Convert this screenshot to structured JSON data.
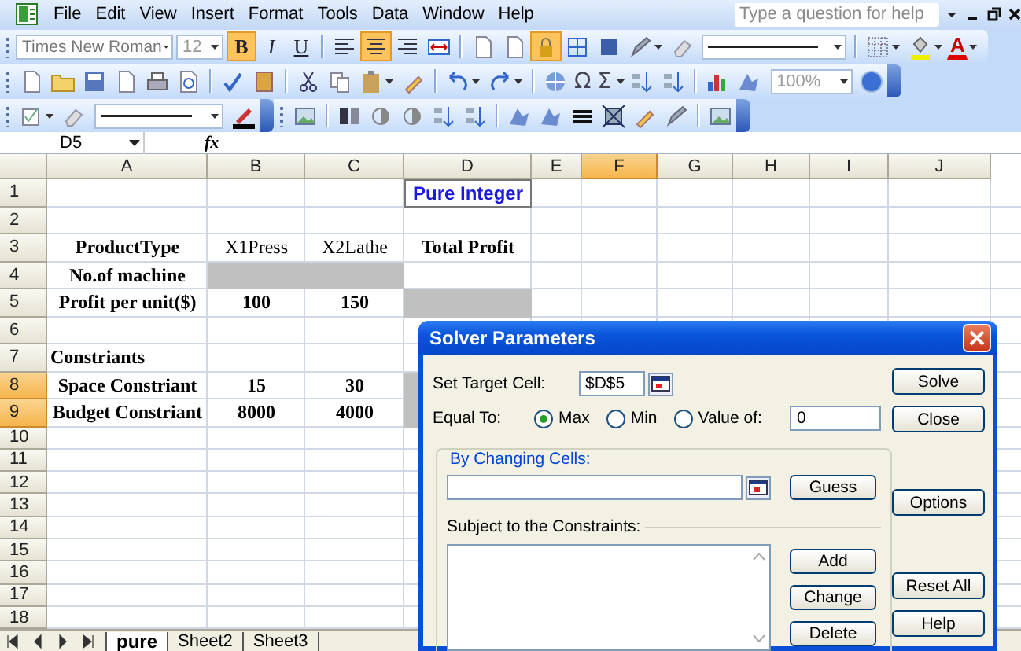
{
  "menu": [
    "File",
    "Edit",
    "View",
    "Insert",
    "Format",
    "Tools",
    "Data",
    "Window",
    "Help"
  ],
  "help_box": {
    "placeholder": "Type a question for help"
  },
  "formatting_toolbar": {
    "font": "Times New Roman",
    "size": "12",
    "style_buttons": [
      {
        "label": "B",
        "selected": true
      },
      {
        "label": "I",
        "selected": false
      },
      {
        "label": "U",
        "selected": false
      }
    ],
    "tool_buttons": [
      {
        "selected": false
      },
      {
        "selected": true
      },
      {
        "selected": false
      },
      {
        "selected": false
      },
      {
        "selected": false
      },
      {
        "selected": false
      },
      {
        "selected": true
      },
      {
        "selected": false
      },
      {
        "selected": false
      },
      {
        "selected": false
      },
      {
        "selected": false
      },
      {
        "selected": false
      },
      {
        "selected": false
      }
    ],
    "font_color_label": "A"
  },
  "standard_toolbar": {
    "symbols": [
      "Ω",
      "Σ"
    ],
    "zoom": "100%"
  },
  "formula_bar": {
    "name_box": "D5",
    "function_label": "fx"
  },
  "columns": [
    {
      "label": "A",
      "selected": false
    },
    {
      "label": "B",
      "selected": false
    },
    {
      "label": "C",
      "selected": false
    },
    {
      "label": "D",
      "selected": false
    },
    {
      "label": "E",
      "selected": false
    },
    {
      "label": "F",
      "selected": true
    },
    {
      "label": "G",
      "selected": false
    },
    {
      "label": "H",
      "selected": false
    },
    {
      "label": "I",
      "selected": false
    },
    {
      "label": "J",
      "selected": false
    }
  ],
  "rows": [
    {
      "label": "1",
      "selected": false,
      "cells": [
        {
          "kind": "empty"
        },
        {
          "kind": "empty"
        },
        {
          "kind": "empty"
        },
        {
          "kind": "title",
          "text": "Pure Integer"
        }
      ]
    },
    {
      "label": "2",
      "selected": false
    },
    {
      "label": "3",
      "selected": false,
      "cells": [
        {
          "kind": "bold",
          "text": "ProductType"
        },
        {
          "kind": "plain",
          "text": "X1Press"
        },
        {
          "kind": "plain",
          "text": "X2Lathe"
        },
        {
          "kind": "bold",
          "text": "Total Profit"
        }
      ]
    },
    {
      "label": "4",
      "selected": false,
      "cells": [
        {
          "kind": "bold",
          "text": "No.of machine"
        },
        {
          "kind": "shaded"
        },
        {
          "kind": "shaded"
        }
      ]
    },
    {
      "label": "5",
      "selected": false,
      "cells": [
        {
          "kind": "bold",
          "text": "Profit per unit($)"
        },
        {
          "kind": "bold",
          "text": "100"
        },
        {
          "kind": "bold",
          "text": "150"
        },
        {
          "kind": "shaded"
        }
      ]
    },
    {
      "label": "6",
      "selected": false
    },
    {
      "label": "7",
      "selected": false,
      "cells": [
        {
          "kind": "bold-left",
          "text": "Constriants"
        }
      ]
    },
    {
      "label": "8",
      "selected": true,
      "cells": [
        {
          "kind": "bold",
          "text": "Space Constriant"
        },
        {
          "kind": "bold",
          "text": "15"
        },
        {
          "kind": "bold",
          "text": "30"
        },
        {
          "kind": "shaded"
        }
      ]
    },
    {
      "label": "9",
      "selected": true,
      "cells": [
        {
          "kind": "bold",
          "text": "Budget Constriant"
        },
        {
          "kind": "bold",
          "text": "8000"
        },
        {
          "kind": "bold",
          "text": "4000"
        },
        {
          "kind": "shaded"
        }
      ]
    },
    {
      "label": "10",
      "selected": false
    },
    {
      "label": "11",
      "selected": false
    },
    {
      "label": "12",
      "selected": false
    },
    {
      "label": "13",
      "selected": false
    },
    {
      "label": "14",
      "selected": false
    },
    {
      "label": "15",
      "selected": false
    },
    {
      "label": "16",
      "selected": false
    },
    {
      "label": "17",
      "selected": false
    },
    {
      "label": "18",
      "selected": false
    }
  ],
  "sheet_tabs": [
    {
      "label": "pure",
      "selected": true
    },
    {
      "label": "Sheet2",
      "selected": false
    },
    {
      "label": "Sheet3",
      "selected": false
    }
  ],
  "solver": {
    "title": "Solver Parameters",
    "target_label": "Set Target Cell:",
    "target_value": "$D$5",
    "equal_label": "Equal To:",
    "equal_to": [
      {
        "label": "Max",
        "selected": true
      },
      {
        "label": "Min",
        "selected": false
      },
      {
        "label": "Value of:",
        "selected": false
      }
    ],
    "value_of": "0",
    "changing_label": "By Changing Cells:",
    "guess": "Guess",
    "constraints_label": "Subject to the Constraints:",
    "constraint_buttons": [
      "Add",
      "Change",
      "Delete"
    ],
    "side_buttons": [
      "Solve",
      "Close",
      "Options",
      "Reset All",
      "Help"
    ]
  }
}
